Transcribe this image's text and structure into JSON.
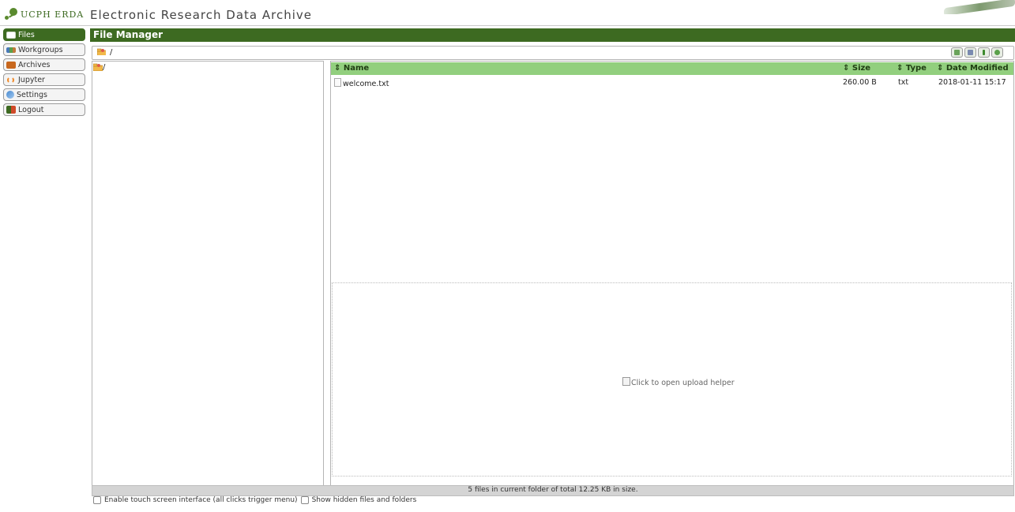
{
  "header": {
    "logo_text": "UCPH ERDA",
    "app_title": "Electronic Research Data Archive"
  },
  "sidebar": {
    "items": [
      {
        "label": "Files",
        "icon": "files-icon",
        "active": true
      },
      {
        "label": "Workgroups",
        "icon": "workgroups-icon",
        "active": false
      },
      {
        "label": "Archives",
        "icon": "archives-icon",
        "active": false
      },
      {
        "label": "Jupyter",
        "icon": "jupyter-icon",
        "active": false
      },
      {
        "label": "Settings",
        "icon": "settings-icon",
        "active": false
      },
      {
        "label": "Logout",
        "icon": "logout-icon",
        "active": false
      }
    ]
  },
  "main": {
    "title": "File Manager",
    "path": "/",
    "tree_root": "/",
    "columns": {
      "name": "⇕ Name",
      "size": "⇕ Size",
      "type": "⇕ Type",
      "modified": "⇕ Date Modified"
    },
    "files": [
      {
        "name": "welcome.txt",
        "size": "260.00 B",
        "type": "txt",
        "modified": "2018-01-11 15:17"
      }
    ],
    "upload_helper": "Click to open upload helper",
    "status": "5 files in current folder of total 12.25 KB in size.",
    "options": {
      "touch": "Enable touch screen interface (all clicks trigger menu)",
      "hidden": "Show hidden files and folders"
    }
  },
  "colors": {
    "brand_green": "#3d6a21",
    "header_green": "#92cf7e",
    "status_gray": "#d4d4d4"
  }
}
